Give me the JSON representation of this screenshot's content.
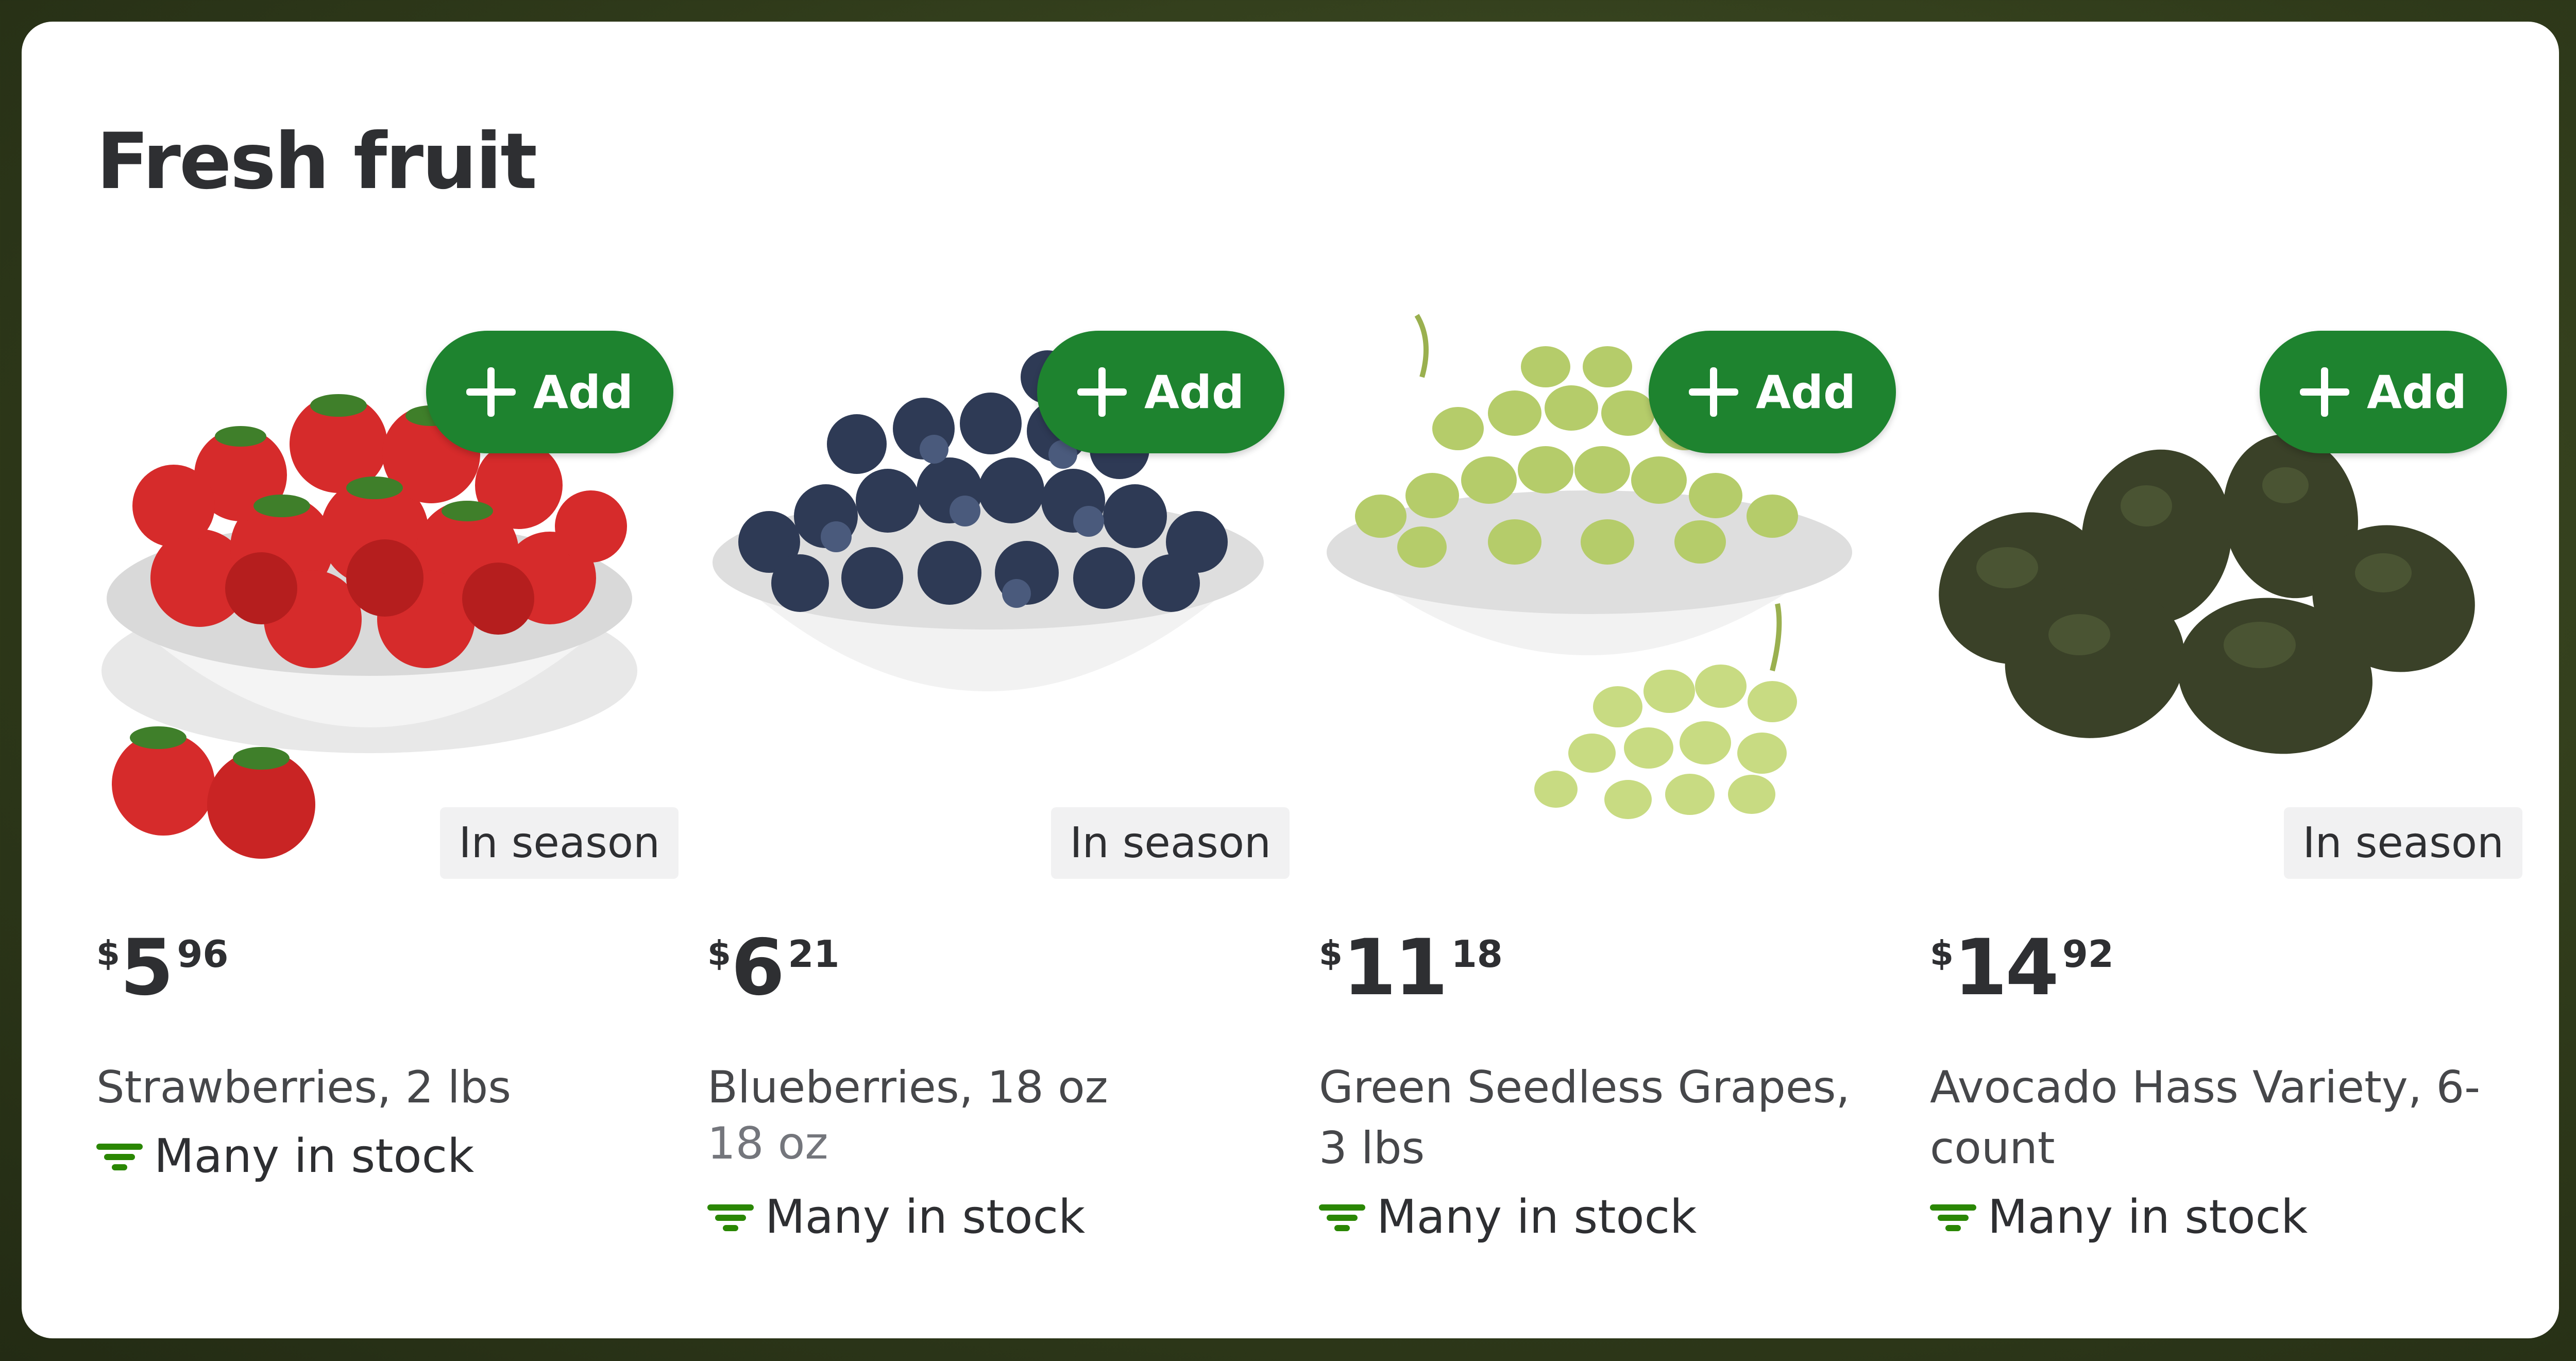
{
  "section": {
    "title": "Fresh fruit"
  },
  "colors": {
    "accent": "#1e832f",
    "stock_icon": "#2a8703",
    "text": "#2e2f32"
  },
  "products": [
    {
      "image_icon": "strawberries-image",
      "add_label": "Add",
      "badge": "In season",
      "price": {
        "currency": "$",
        "dollars": "5",
        "cents": "96"
      },
      "name": "Strawberries, 2 lbs",
      "subname": "",
      "stock": "Many in stock"
    },
    {
      "image_icon": "blueberries-image",
      "add_label": "Add",
      "badge": "In season",
      "price": {
        "currency": "$",
        "dollars": "6",
        "cents": "21"
      },
      "name": "Blueberries, 18 oz",
      "subname": "18 oz",
      "stock": "Many in stock"
    },
    {
      "image_icon": "grapes-image",
      "add_label": "Add",
      "badge": "",
      "price": {
        "currency": "$",
        "dollars": "11",
        "cents": "18"
      },
      "name": "Green Seedless Grapes, 3 lbs",
      "subname": "",
      "stock": "Many in stock"
    },
    {
      "image_icon": "avocados-image",
      "add_label": "Add",
      "badge": "In season",
      "price": {
        "currency": "$",
        "dollars": "14",
        "cents": "92"
      },
      "name": "Avocado Hass Variety, 6-count",
      "subname": "",
      "stock": "Many in stock"
    }
  ]
}
